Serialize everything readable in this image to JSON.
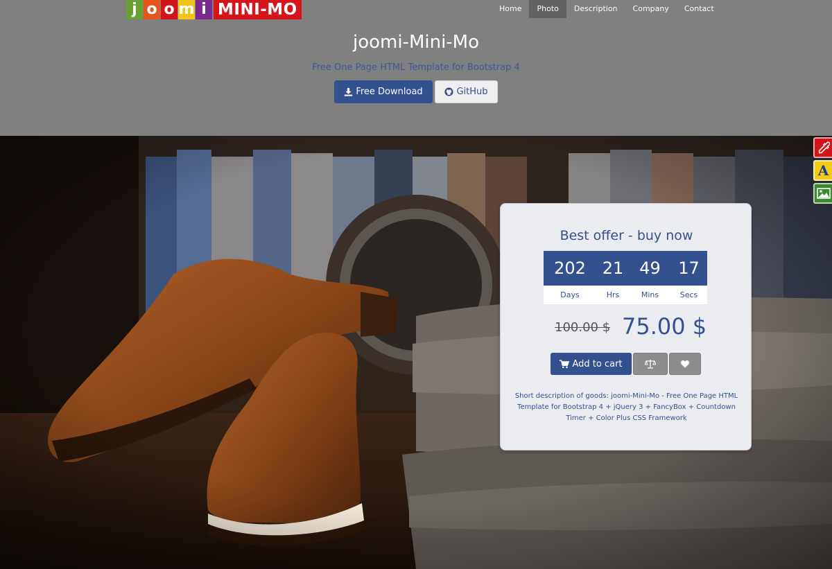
{
  "header": {
    "logo": {
      "letters": [
        "j",
        "o",
        "o",
        "m",
        "i"
      ],
      "word": "MINI-MO"
    },
    "nav": [
      "Home",
      "Photo",
      "Description",
      "Company",
      "Contact"
    ],
    "active_nav": "Photo",
    "title": "joomi-Mini-Mo",
    "subtitle": "Free One Page HTML Template for Bootstrap 4",
    "buttons": {
      "download": "Free Download",
      "github": "GitHub"
    }
  },
  "side_tools": [
    {
      "icon": "eyedropper-icon"
    },
    {
      "icon": "font-icon",
      "label": "A"
    },
    {
      "icon": "image-icon"
    }
  ],
  "offer": {
    "title": "Best offer - buy now",
    "countdown": {
      "days": "202",
      "hours": "21",
      "mins": "49",
      "secs": "17",
      "labels": {
        "days": "Days",
        "hours": "Hrs",
        "mins": "Mins",
        "secs": "Secs"
      }
    },
    "old_price": "100.00 $",
    "new_price": "75.00 $",
    "buttons": {
      "cart": "Add to cart",
      "compare_icon": "balance-scale-icon",
      "wishlist_icon": "heart-icon"
    },
    "description": "Short description of goods: joomi-Mini-Mo - Free One Page HTML Template for Bootstrap 4 + jQuery 3 + FancyBox + Countdown Timer + Color Plus CSS Framework"
  },
  "colors": {
    "header_bg": "#808080",
    "primary": "#33508f",
    "card_bg": "#ebecf0",
    "logo_red": "#d7141a",
    "tool_red": "#d3141b",
    "tool_yellow": "#f2cc12",
    "tool_green": "#3d8a33"
  }
}
